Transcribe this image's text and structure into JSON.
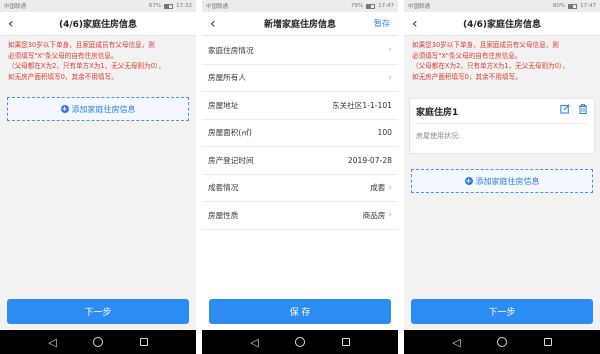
{
  "status": {
    "carrier": "中国联通",
    "s1": {
      "percent": "67%",
      "time": "17:32"
    },
    "s2": {
      "percent": "79%",
      "time": "17:47"
    },
    "s3": {
      "percent": "80%",
      "time": "17:47"
    }
  },
  "screen1": {
    "title": "(4/6)家庭住房信息",
    "notice": [
      "如果您30岁以下单身，且家庭成员有父母信息，则",
      "必须填写\"X\"条父母的自有住房信息。",
      "（父母都在X为2，只有单方X为1，无父无母则为0），",
      "如无房产面积填写0，其余不用填写。"
    ],
    "add_label": "添加家庭住房信息",
    "next_label": "下一步"
  },
  "screen2": {
    "title": "新增家庭住房信息",
    "save_top": "暂存",
    "rows": [
      {
        "label": "家庭住房情况",
        "value": ""
      },
      {
        "label": "房屋所有人",
        "value": ""
      },
      {
        "label": "房屋地址",
        "value": "东关社区1-1-101"
      },
      {
        "label": "房屋面积(㎡)",
        "value": "100"
      },
      {
        "label": "房产登记时间",
        "value": "2019-07-28"
      },
      {
        "label": "成套情况",
        "value": "成套"
      },
      {
        "label": "房屋性质",
        "value": "商品房"
      }
    ],
    "save_label": "保 存"
  },
  "screen3": {
    "title": "(4/6)家庭住房信息",
    "notice": [
      "如果您30岁以下单身，且家庭成员有父母信息，则",
      "必须填写\"X\"条父母的自有住房信息。",
      "（父母都在X为2，只有单方X为1，无父无母则为0），",
      "如无房产面积填写0，其余不用填写。"
    ],
    "card_title": "家庭住房1",
    "card_status_label": "房屋使用状况:",
    "add_label": "添加家庭住房信息",
    "next_label": "下一步"
  },
  "icons": {
    "back": "chevron-left-icon",
    "edit": "edit-icon",
    "delete": "trash-icon",
    "plus": "plus-circle-icon"
  },
  "colors": {
    "accent": "#2b8cf2",
    "warning": "#e0392b"
  }
}
